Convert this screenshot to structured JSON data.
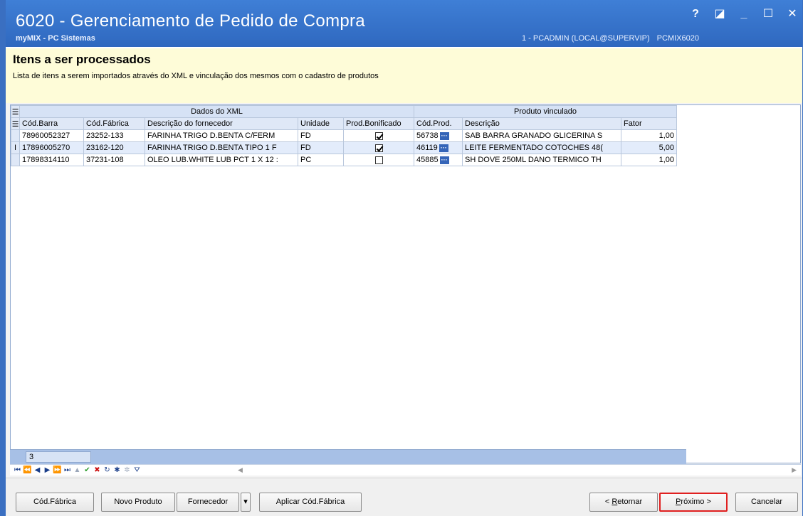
{
  "window": {
    "title": "6020 - Gerenciamento de Pedido de Compra",
    "subtitle": "myMIX - PC Sistemas",
    "user_info": "1 - PCADMIN (LOCAL@SUPERVIP)",
    "environment": "PCMIX6020",
    "controls": {
      "help": "?",
      "restore": "◪",
      "minimize": "_",
      "maximize": "☐",
      "close": "✕"
    }
  },
  "header": {
    "title": "Itens a ser processados",
    "description": "Lista de itens a serem importados através do XML e vinculação dos mesmos com o cadastro de produtos"
  },
  "grid": {
    "band_xml": "Dados do XML",
    "band_produto": "Produto vinculado",
    "columns": {
      "cod_barra": "Cód.Barra",
      "cod_fabrica": "Cód.Fábrica",
      "descricao_fornecedor": "Descrição do fornecedor",
      "unidade": "Unidade",
      "prod_bonificado": "Prod.Bonificado",
      "cod_prod": "Cód.Prod.",
      "descricao": "Descrição",
      "fator": "Fator"
    },
    "rows": [
      {
        "indicator": "",
        "cod_barra": "78960052327",
        "cod_fabrica": "23252-133",
        "descricao_fornecedor": "FARINHA TRIGO D.BENTA C/FERM",
        "unidade": "FD",
        "prod_bonificado": true,
        "cod_prod": "56738",
        "descricao": "SAB BARRA GRANADO GLICERINA S",
        "fator": "1,00"
      },
      {
        "indicator": "I",
        "cod_barra": "17896005270",
        "cod_fabrica": "23162-120",
        "descricao_fornecedor": "FARINHA TRIGO D.BENTA TIPO 1 F",
        "unidade": "FD",
        "prod_bonificado": true,
        "cod_prod": "46119",
        "descricao": "LEITE FERMENTADO COTOCHES 48(",
        "fator": "5,00"
      },
      {
        "indicator": "",
        "cod_barra": "17898314110",
        "cod_fabrica": "37231-108",
        "descricao_fornecedor": "OLEO LUB.WHITE LUB PCT 1 X 12 :",
        "unidade": "PC",
        "prod_bonificado": false,
        "cod_prod": "45885",
        "descricao": "SH DOVE 250ML DANO TERMICO TH",
        "fator": "1,00"
      }
    ],
    "footer_count": "3"
  },
  "buttons": {
    "cod_fabrica": "Cód.Fábrica",
    "novo_produto": "Novo Produto",
    "fornecedor": "Fornecedor",
    "aplicar": "Aplicar Cód.Fábrica",
    "retornar_prefix": "< ",
    "retornar_key": "R",
    "retornar_rest": "etornar",
    "proximo_key": "P",
    "proximo_rest": "róximo >",
    "cancelar": "Cancelar"
  }
}
